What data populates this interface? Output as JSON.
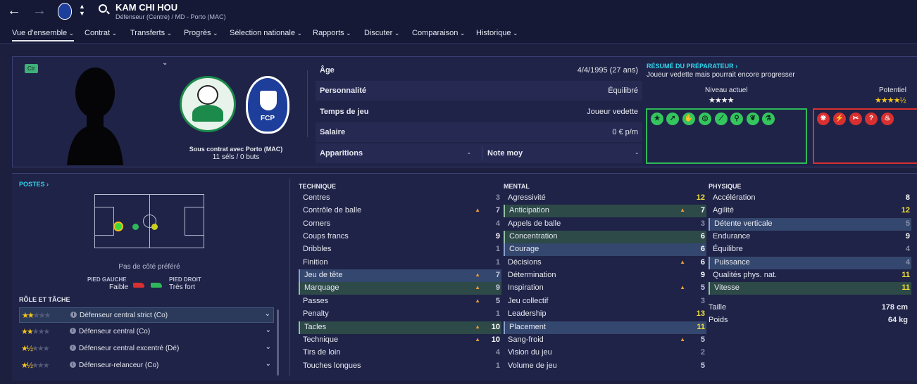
{
  "header": {
    "player_name": "KAM CHI HOU",
    "subtitle": "Défenseur (Centre) / MD - Porto (MAC)",
    "back_icon": "←",
    "forward_icon": "→",
    "updown_icon": "⌃⌄"
  },
  "menu": [
    "Vue d'ensemble",
    "Contrat",
    "Transferts",
    "Progrès",
    "Sélection nationale",
    "Rapports",
    "Discuter",
    "Comparaison",
    "Historique"
  ],
  "profile": {
    "position_badge": "Ctr",
    "contract": "Sous contrat avec Porto (MAC)",
    "caps": "11 séls / 0 buts",
    "club_crest_text": "FCP"
  },
  "info": {
    "age_label": "Âge",
    "age_value": "4/4/1995 (27 ans)",
    "personality_label": "Personnalité",
    "personality_value": "Équilibré",
    "playtime_label": "Temps de jeu",
    "playtime_value": "Joueur vedette",
    "salary_label": "Salaire",
    "salary_value": "0 € p/m",
    "apps_label": "Apparitions",
    "apps_value": "-",
    "rating_label": "Note moy",
    "rating_value": "-"
  },
  "coach_report": {
    "title": "RÉSUMÉ DU PRÉPARATEUR ›",
    "description": "Joueur vedette mais pourrait encore progresser",
    "current_label": "Niveau actuel",
    "current_stars": "★★★★",
    "potential_label": "Potentiel",
    "potential_stars": "★★★★½",
    "strength_icons": [
      "★",
      "↗",
      "✋",
      "◎",
      "⟋",
      "⚲",
      "❦",
      "⚗"
    ],
    "weakness_icons": [
      "❋",
      "⚡",
      "✂",
      "?",
      "♨"
    ]
  },
  "positions": {
    "title": "POSTES ›",
    "side_note": "Pas de côté préféré",
    "left_foot_label": "PIED GAUCHE",
    "left_foot_value": "Faible",
    "right_foot_label": "PIED DROIT",
    "right_foot_value": "Très fort"
  },
  "roles": {
    "title": "RÔLE ET TÂCHE",
    "items": [
      {
        "name": "Défenseur central strict (Co)",
        "on": "★★",
        "off": "★★★"
      },
      {
        "name": "Défenseur central (Co)",
        "on": "★★",
        "off": "★★★"
      },
      {
        "name": "Défenseur central excentré (Dé)",
        "on": "★½",
        "off": "★★★"
      },
      {
        "name": "Défenseur-relanceur (Co)",
        "on": "★½",
        "off": "★★★"
      }
    ],
    "chevron": "⌄",
    "info_icon": "i"
  },
  "technique": {
    "title": "TECHNIQUE",
    "items": [
      {
        "name": "Centres",
        "value": "3"
      },
      {
        "name": "Contrôle de balle",
        "value": "7",
        "arrow": "▲"
      },
      {
        "name": "Corners",
        "value": "4"
      },
      {
        "name": "Coups francs",
        "value": "9"
      },
      {
        "name": "Dribbles",
        "value": "1"
      },
      {
        "name": "Finition",
        "value": "1"
      },
      {
        "name": "Jeu de tête",
        "value": "7",
        "arrow": "▲"
      },
      {
        "name": "Marquage",
        "value": "9",
        "arrow": "▲"
      },
      {
        "name": "Passes",
        "value": "5",
        "arrow": "▲"
      },
      {
        "name": "Penalty",
        "value": "1"
      },
      {
        "name": "Tacles",
        "value": "10",
        "arrow": "▲"
      },
      {
        "name": "Technique",
        "value": "10",
        "arrow": "▲"
      },
      {
        "name": "Tirs de loin",
        "value": "4"
      },
      {
        "name": "Touches longues",
        "value": "1"
      }
    ]
  },
  "mental": {
    "title": "MENTAL",
    "items": [
      {
        "name": "Agressivité",
        "value": "12"
      },
      {
        "name": "Anticipation",
        "value": "7",
        "arrow": "▲"
      },
      {
        "name": "Appels de balle",
        "value": "3"
      },
      {
        "name": "Concentration",
        "value": "6"
      },
      {
        "name": "Courage",
        "value": "6"
      },
      {
        "name": "Décisions",
        "value": "6",
        "arrow": "▲"
      },
      {
        "name": "Détermination",
        "value": "9"
      },
      {
        "name": "Inspiration",
        "value": "5",
        "arrow": "▲"
      },
      {
        "name": "Jeu collectif",
        "value": "3"
      },
      {
        "name": "Leadership",
        "value": "13"
      },
      {
        "name": "Placement",
        "value": "11"
      },
      {
        "name": "Sang-froid",
        "value": "5",
        "arrow": "▲"
      },
      {
        "name": "Vision du jeu",
        "value": "2"
      },
      {
        "name": "Volume de jeu",
        "value": "5"
      }
    ]
  },
  "physique": {
    "title": "PHYSIQUE",
    "items": [
      {
        "name": "Accélération",
        "value": "8"
      },
      {
        "name": "Agilité",
        "value": "12"
      },
      {
        "name": "Détente verticale",
        "value": "5"
      },
      {
        "name": "Endurance",
        "value": "9"
      },
      {
        "name": "Équilibre",
        "value": "4"
      },
      {
        "name": "Puissance",
        "value": "4"
      },
      {
        "name": "Qualités phys. nat.",
        "value": "11"
      },
      {
        "name": "Vitesse",
        "value": "11"
      }
    ],
    "height_label": "Taille",
    "height_value": "178 cm",
    "weight_label": "Poids",
    "weight_value": "64 kg"
  },
  "colors": {
    "accent": "#32d4ec",
    "strength": "#2fb85a",
    "weakness": "#d83030",
    "value_yellow": "#f3e236"
  }
}
